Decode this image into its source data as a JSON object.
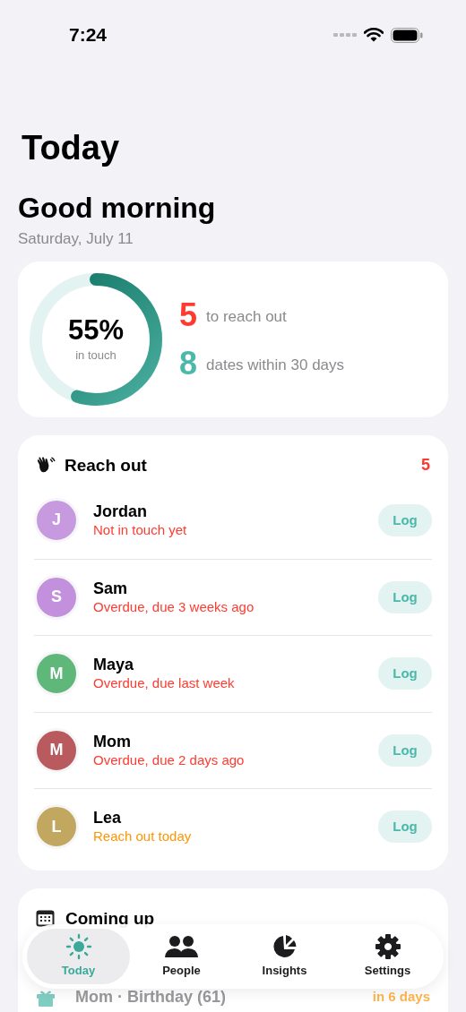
{
  "status_bar": {
    "time": "7:24"
  },
  "title": "Today",
  "greeting": "Good morning",
  "date": "Saturday, July 11",
  "summary": {
    "ring": {
      "level": 0.55,
      "value": "55%",
      "caption": "in touch"
    },
    "stats": [
      {
        "number": "5",
        "label": "to reach out",
        "color": "#ff3b30"
      },
      {
        "number": "8",
        "label": "dates within 30 days",
        "color": "#4bb8a9"
      }
    ]
  },
  "reach_out": {
    "title": "Reach out",
    "count": "5",
    "people": [
      {
        "initial": "J",
        "name": "Jordan",
        "status": "Not in touch yet",
        "kind": "overdue",
        "color": "#c79ae0",
        "button": "Log"
      },
      {
        "initial": "S",
        "name": "Sam",
        "status": "Overdue, due 3 weeks ago",
        "kind": "overdue",
        "color": "#c290dc",
        "button": "Log"
      },
      {
        "initial": "M",
        "name": "Maya",
        "status": "Overdue, due last week",
        "kind": "overdue",
        "color": "#5fb77a",
        "button": "Log"
      },
      {
        "initial": "M",
        "name": "Mom",
        "status": "Overdue, due 2 days ago",
        "kind": "overdue",
        "color": "#b95a5e",
        "button": "Log"
      },
      {
        "initial": "L",
        "name": "Lea",
        "status": "Reach out today",
        "kind": "today",
        "color": "#c2a760",
        "button": "Log"
      }
    ]
  },
  "coming_up": {
    "title": "Coming up",
    "items": [
      {
        "text": "Mom · Birthday (61)",
        "when": "in 6 days"
      }
    ]
  },
  "tab_bar": [
    {
      "label": "Today",
      "kind": "sun",
      "selected": true
    },
    {
      "label": "People",
      "kind": "people",
      "selected": false
    },
    {
      "label": "Insights",
      "kind": "pie",
      "selected": false
    },
    {
      "label": "Settings",
      "kind": "gear",
      "selected": false
    }
  ]
}
